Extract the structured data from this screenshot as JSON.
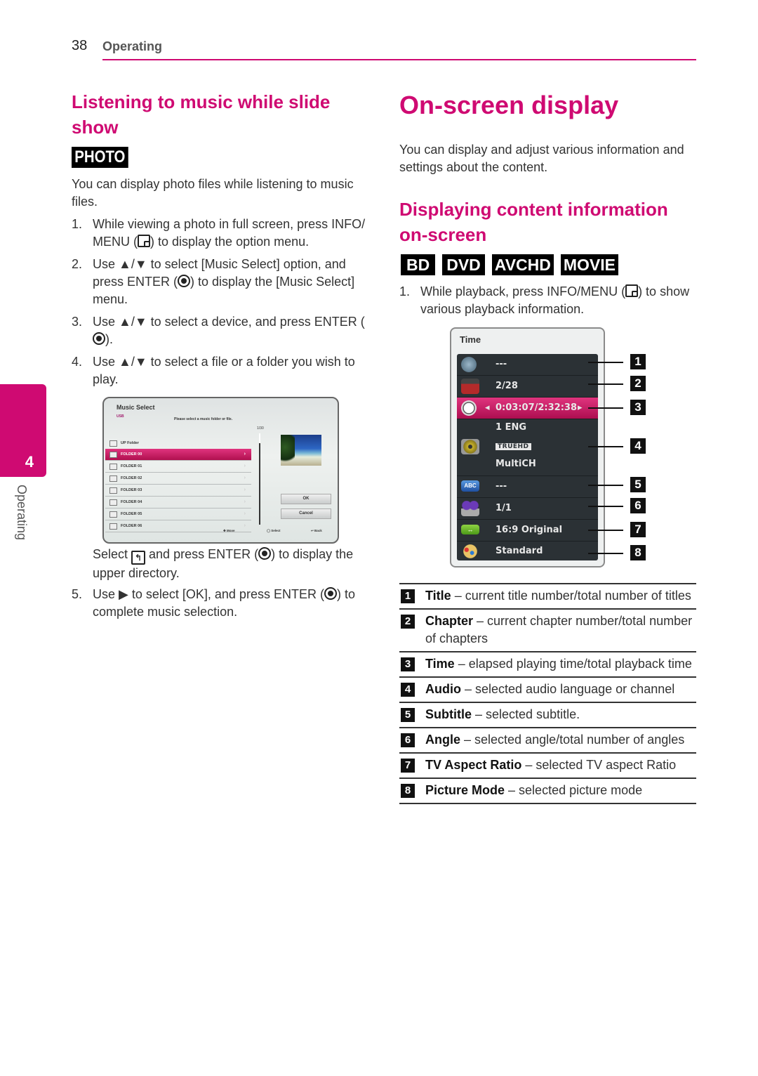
{
  "header": {
    "page_number": "38",
    "section": "Operating"
  },
  "side_tab": {
    "chapter_number": "4",
    "chapter_label": "Operating"
  },
  "left": {
    "title": "Listening to music while slide show",
    "badge": "PHOTO",
    "intro": "You can display photo files while listening to music files.",
    "steps": [
      {
        "num": "1.",
        "pre": "While viewing a photo in full screen, press INFO/ MENU (",
        "icon": "info-menu-icon",
        "post": ") to display the option menu."
      },
      {
        "num": "2.",
        "pre": "Use ▲/▼ to select [Music Select] option, and press ENTER (",
        "icon": "enter-icon",
        "post": ") to display the [Music Select] menu."
      },
      {
        "num": "3.",
        "pre": "Use ▲/▼ to select a device, and press ENTER (",
        "icon": "enter-icon",
        "post": ")."
      },
      {
        "num": "4.",
        "pre": "Use ▲/▼ to select a file or a folder you wish to play.",
        "icon": "",
        "post": ""
      }
    ],
    "note": {
      "pre": "Select ",
      "icon": "up-folder-icon",
      "mid": " and press ENTER (",
      "icon2": "enter-icon",
      "post": ") to display the upper directory."
    },
    "step5": {
      "num": "5.",
      "pre": "Use ▶ to select [OK], and press ENTER (",
      "icon": "enter-icon",
      "post": ") to complete music selection."
    }
  },
  "music_select": {
    "title": "Music Select",
    "device": "USB",
    "prompt": "Please select a music folder or file.",
    "count": "1/30",
    "up_folder": "UP Folder",
    "items": [
      "FOLDER 00",
      "FOLDER 01",
      "FOLDER 02",
      "FOLDER 03",
      "FOLDER 04",
      "FOLDER 05",
      "FOLDER 06"
    ],
    "selected_index": 0,
    "ok_label": "OK",
    "cancel_label": "Cancel",
    "footer": {
      "move": "Move",
      "select": "Select",
      "back": "Back"
    }
  },
  "right": {
    "title": "On-screen display",
    "intro": "You can display and adjust various information and settings about the content.",
    "subtitle": "Displaying content information on-screen",
    "badges": [
      "BD",
      "DVD",
      "AVCHD",
      "MOVIE"
    ],
    "step1": {
      "num": "1.",
      "pre": "While playback, press INFO/MENU (",
      "icon": "info-menu-icon",
      "post": ") to show various playback information."
    }
  },
  "osd": {
    "header": "Time",
    "rows": [
      {
        "icon": "title-disc-icon",
        "value": "---",
        "callout": "1"
      },
      {
        "icon": "chapter-clapper-icon",
        "value": "2/28",
        "callout": "2"
      },
      {
        "icon": "clock-icon",
        "value": "0:03:07/2:32:38",
        "callout": "3",
        "selected": true
      },
      {
        "icon": "speaker-icon",
        "value": "1 ENG",
        "value2": "TRUEHD",
        "value3": "MultiCH",
        "callout": "4"
      },
      {
        "icon": "subtitle-abc-icon",
        "value": "---",
        "callout": "5"
      },
      {
        "icon": "angle-camera-icon",
        "value": "1/1",
        "callout": "6"
      },
      {
        "icon": "aspect-ratio-icon",
        "value": "16:9 Original",
        "callout": "7"
      },
      {
        "icon": "palette-icon",
        "value": "Standard",
        "callout": "8"
      }
    ]
  },
  "legend": [
    {
      "key": "1",
      "term": "Title",
      "desc": " – current title number/total number of titles"
    },
    {
      "key": "2",
      "term": "Chapter",
      "desc": " – current chapter number/total number of chapters"
    },
    {
      "key": "3",
      "term": "Time",
      "desc": " – elapsed playing time/total playback time"
    },
    {
      "key": "4",
      "term": "Audio",
      "desc": " – selected audio language or channel"
    },
    {
      "key": "5",
      "term": "Subtitle",
      "desc": " – selected subtitle."
    },
    {
      "key": "6",
      "term": "Angle",
      "desc": " – selected angle/total number of angles"
    },
    {
      "key": "7",
      "term": "TV Aspect Ratio",
      "desc": " – selected TV aspect Ratio"
    },
    {
      "key": "8",
      "term": "Picture Mode",
      "desc": " – selected picture mode"
    }
  ],
  "colors": {
    "accent": "#cf0a72",
    "osd_panel": "#2b3135",
    "osd_selected": "#d6206c"
  }
}
